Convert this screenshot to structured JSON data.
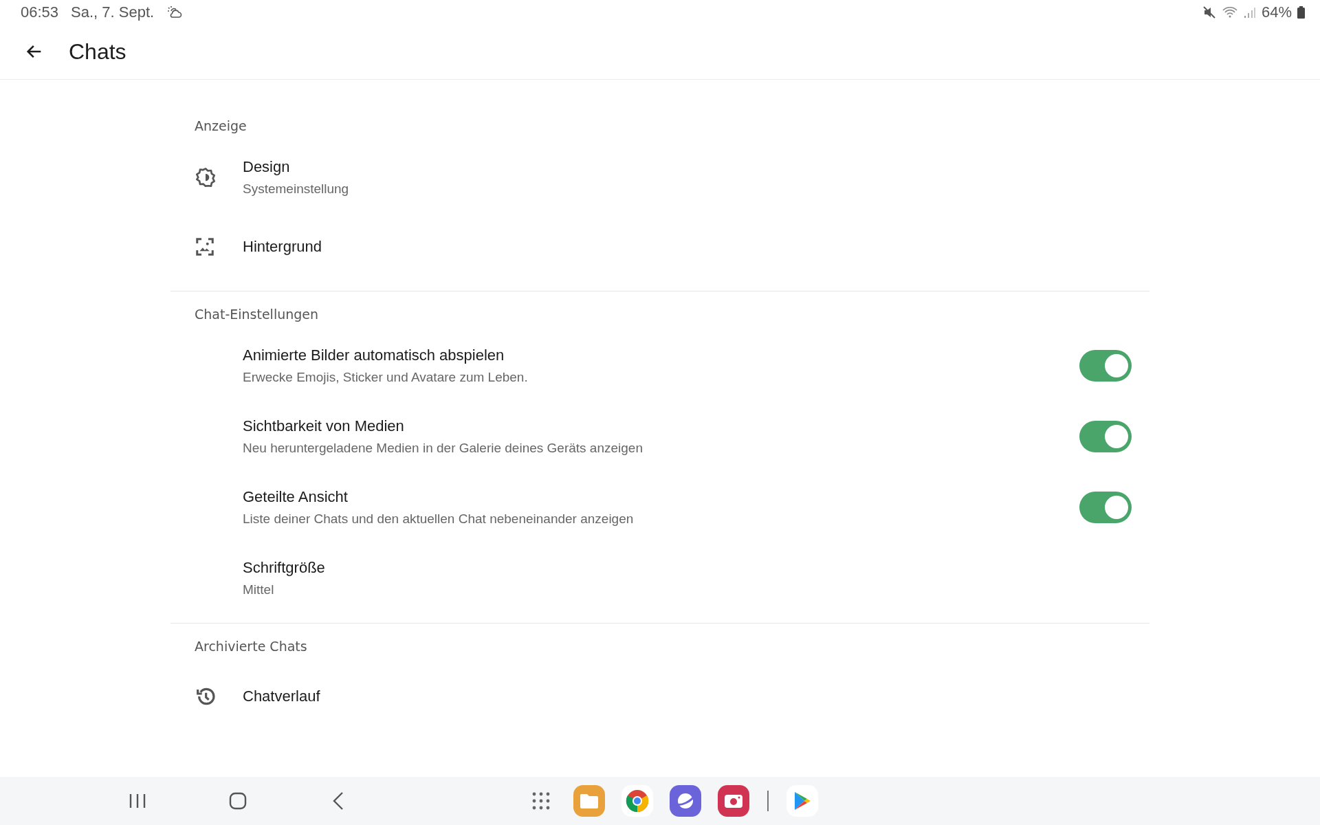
{
  "status_bar": {
    "time": "06:53",
    "date": "Sa., 7. Sept.",
    "battery": "64%"
  },
  "header": {
    "title": "Chats"
  },
  "sections": [
    {
      "title": "Anzeige",
      "items": [
        {
          "kind": "plain",
          "title": "Design",
          "subtitle": "Systemeinstellung"
        },
        {
          "kind": "plain",
          "title": "Hintergrund"
        }
      ]
    },
    {
      "title": "Chat-Einstellungen",
      "items": [
        {
          "kind": "toggle",
          "title": "Animierte Bilder automatisch abspielen",
          "subtitle": "Erwecke Emojis, Sticker und Avatare zum Leben.",
          "on": true
        },
        {
          "kind": "toggle",
          "title": "Sichtbarkeit von Medien",
          "subtitle": "Neu heruntergeladene Medien in der Galerie deines Geräts anzeigen",
          "on": true
        },
        {
          "kind": "toggle",
          "title": "Geteilte Ansicht",
          "subtitle": "Liste deiner Chats und den aktuellen Chat nebeneinander anzeigen",
          "on": true
        },
        {
          "kind": "plain",
          "title": "Schriftgröße",
          "subtitle": "Mittel"
        }
      ]
    },
    {
      "title": "Archivierte Chats",
      "items": [
        {
          "kind": "plain",
          "title": "Chatverlauf"
        }
      ]
    }
  ]
}
